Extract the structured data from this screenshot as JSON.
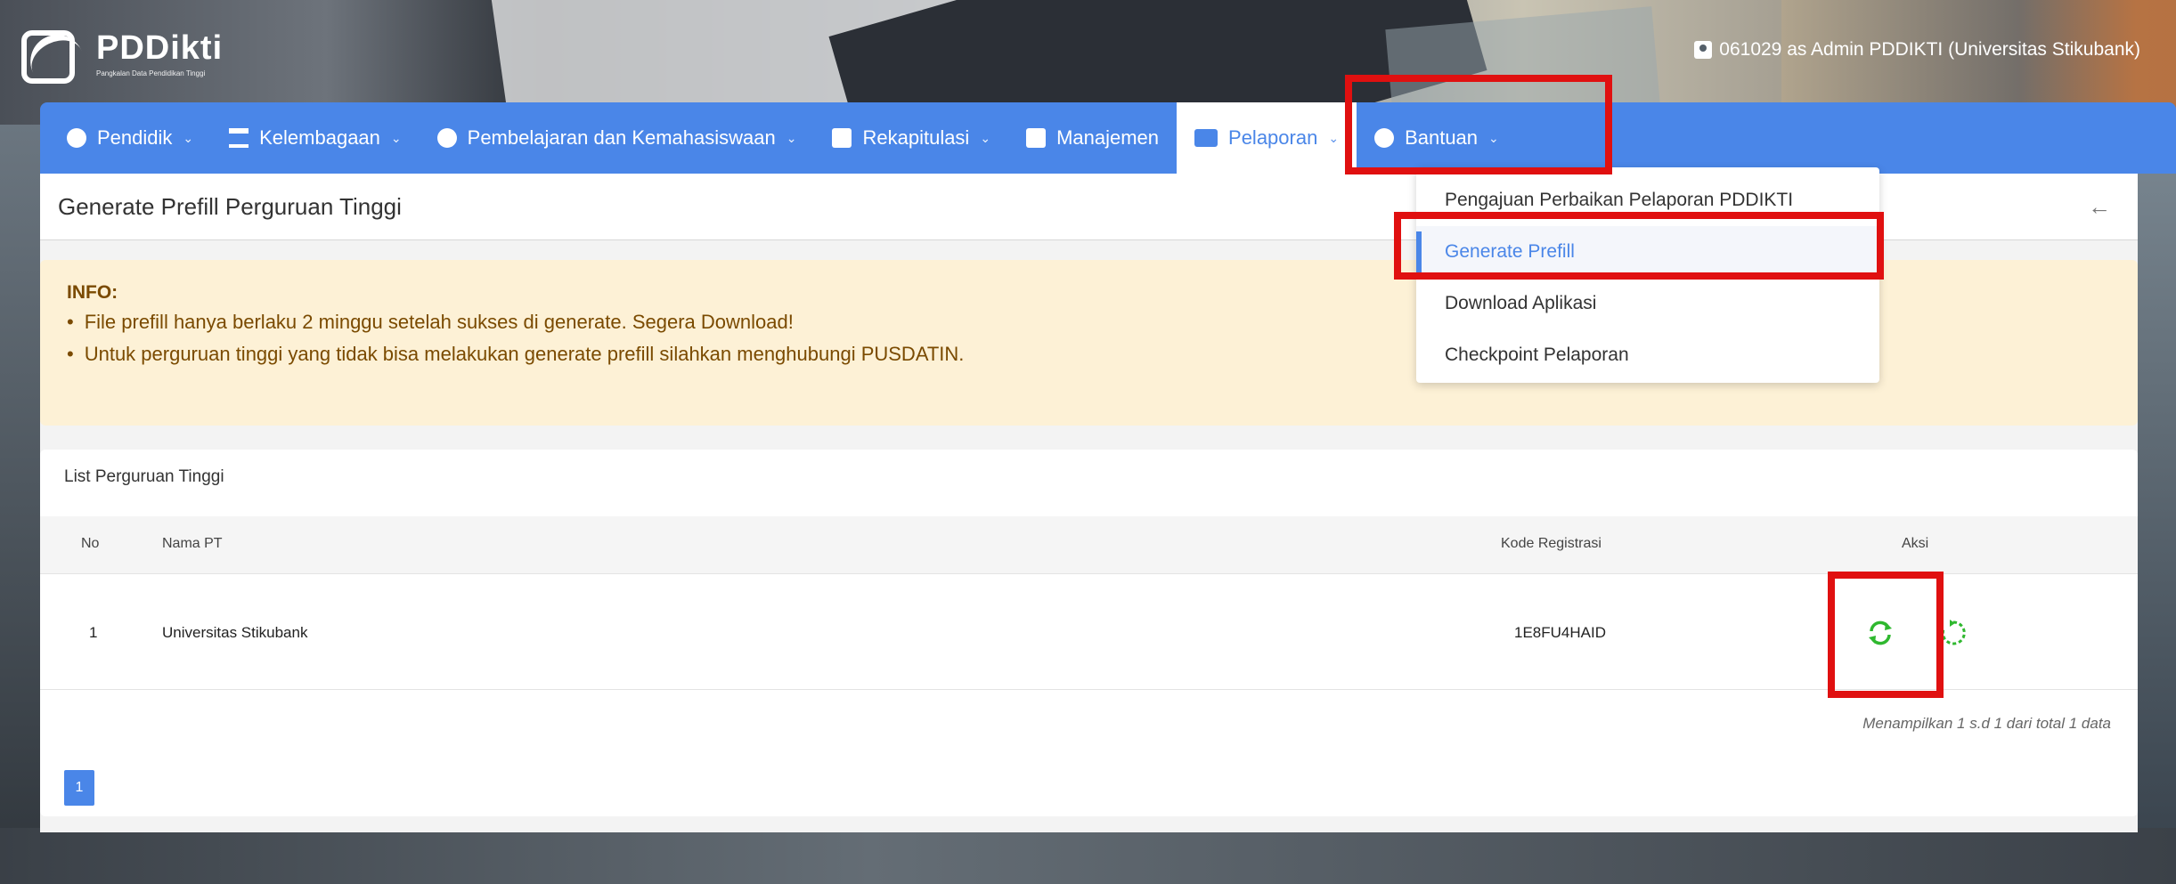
{
  "app": {
    "logo_title": "PDDikti",
    "logo_subtitle": "Pangkalan Data Pendidikan Tinggi",
    "user_info": "061029 as Admin PDDIKTI (Universitas Stikubank)"
  },
  "navbar": {
    "items": [
      {
        "label": "Pendidik",
        "icon": "user-circle-icon"
      },
      {
        "label": "Kelembagaan",
        "icon": "bank-icon"
      },
      {
        "label": "Pembelajaran dan Kemahasiswaan",
        "icon": "user-circle-icon"
      },
      {
        "label": "Rekapitulasi",
        "icon": "chart-icon"
      },
      {
        "label": "Manajemen",
        "icon": "document-icon"
      },
      {
        "label": "Pelaporan",
        "icon": "folder-icon"
      },
      {
        "label": "Bantuan",
        "icon": "user-circle-icon"
      }
    ]
  },
  "dropdown": {
    "items": [
      "Pengajuan Perbaikan Pelaporan PDDIKTI",
      "Generate Prefill",
      "Download Aplikasi",
      "Checkpoint Pelaporan"
    ]
  },
  "page": {
    "title": "Generate Prefill Perguruan Tinggi",
    "back_icon": "arrow-left-icon"
  },
  "info": {
    "title": "INFO:",
    "lines": [
      "File prefill hanya berlaku 2 minggu setelah sukses di generate. Segera Download!",
      "Untuk perguruan tinggi yang tidak bisa melakukan generate prefill silahkan menghubungi PUSDATIN."
    ]
  },
  "list": {
    "title": "List Perguruan Tinggi",
    "columns": [
      "No",
      "Nama PT",
      "Kode Registrasi",
      "Aksi"
    ],
    "rows": [
      {
        "no": "1",
        "nama": "Universitas Stikubank",
        "kode": "1E8FU4HAID"
      }
    ],
    "summary": "Menampilkan 1 s.d 1 dari total 1 data",
    "page": "1"
  },
  "colors": {
    "primary": "#4a86e8",
    "info_bg": "#fdf1d6",
    "highlight": "#e01010",
    "action_green": "#2fb82f"
  }
}
